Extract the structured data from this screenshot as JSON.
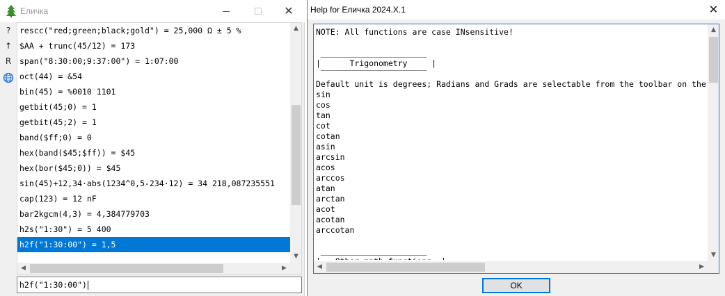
{
  "left_window": {
    "title": "Еличка",
    "toolbar": {
      "help_label": "?",
      "up_label": "↑",
      "r_label": "R",
      "globe_icon": "globe-icon"
    },
    "history": [
      "rescc(\"red;green;black;gold\") = 25,000 Ω ± 5 %",
      "$AA + trunc(45/12) = 173",
      "span(\"8:30:00;9:37:00\") = 1:07:00",
      "oct(44) = &54",
      "bin(45) = %0010 1101",
      "getbit(45;0) = 1",
      "getbit(45;2) = 1",
      "band($ff;0) = 0",
      "hex(band($45;$ff)) = $45",
      "hex(bor($45;0)) = $45",
      "sin(45)+12,34·abs(1234^0,5-234·12) = 34 218,087235551",
      "cap(123) = 12 nF",
      "bar2kgcm(4,3) = 4,384779703",
      "h2s(\"1:30\") = 5 400",
      "h2f(\"1:30:00\") = 1,5"
    ],
    "selected_index": 14,
    "input_value": "h2f(\"1:30:00\")"
  },
  "right_window": {
    "title": "Help for Еличка 2024.X.1",
    "help_lines": [
      "NOTE: All functions are case INsensitive!",
      "",
      " ______________________",
      "|      Trigonometry     |",
      " ‾‾‾‾‾‾‾‾‾‾‾‾‾‾‾‾‾‾‾‾‾‾",
      "Default unit is degrees; Radians and Grads are selectable from the toolbar on the",
      "sin",
      "cos",
      "tan",
      "cot",
      "cotan",
      "asin",
      "arcsin",
      "acos",
      "arccos",
      "atan",
      "arctan",
      "acot",
      "acotan",
      "arccotan",
      "",
      " ______________________",
      "|   Other math functions  |"
    ],
    "ok_label": "OK"
  },
  "colors": {
    "selection": "#0078d7",
    "focus_border": "#3c6fb4"
  }
}
